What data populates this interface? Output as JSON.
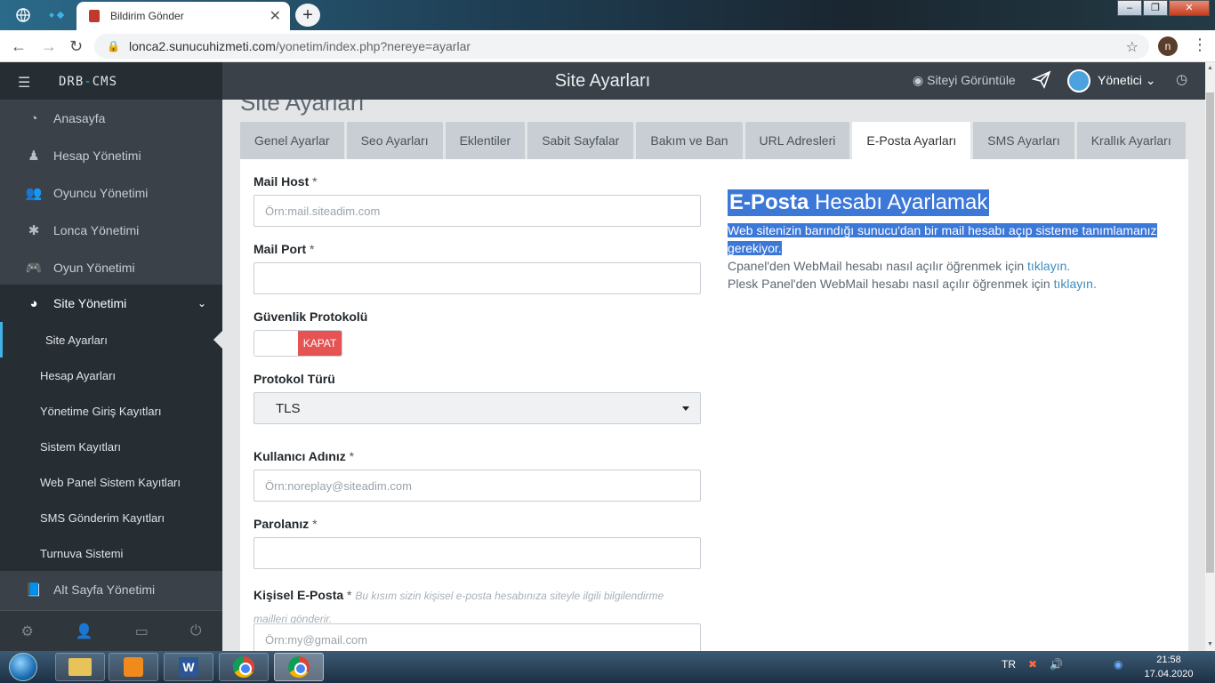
{
  "browser": {
    "tab_title": "Bildirim Gönder",
    "url_host": "lonca2.sunucuhizmeti.com",
    "url_path": "/yonetim/index.php?nereye=ayarlar",
    "profile_initial": "n"
  },
  "app": {
    "brand_left": "DRB",
    "brand_sep": "-",
    "brand_right": "CMS",
    "header_title": "Site Ayarları",
    "view_site": "Siteyi Görüntüle",
    "user_label": "Yönetici"
  },
  "sidebar": {
    "items": [
      {
        "label": "Anasayfa",
        "icon": "dashboard-icon"
      },
      {
        "label": "Hesap Yönetimi",
        "icon": "user-icon"
      },
      {
        "label": "Oyuncu Yönetimi",
        "icon": "users-icon"
      },
      {
        "label": "Lonca Yönetimi",
        "icon": "asterisk-icon"
      },
      {
        "label": "Oyun Yönetimi",
        "icon": "gamepad-icon"
      },
      {
        "label": "Site Yönetimi",
        "icon": "globe-icon"
      },
      {
        "label": "Alt Sayfa Yönetimi",
        "icon": "book-icon"
      }
    ],
    "submenu": [
      "Site Ayarları",
      "Hesap Ayarları",
      "Yönetime Giriş Kayıtları",
      "Sistem Kayıtları",
      "Web Panel Sistem Kayıtları",
      "SMS Gönderim Kayıtları",
      "Turnuva Sistemi"
    ]
  },
  "main": {
    "heading": "Site Ayarları",
    "tabs": [
      "Genel Ayarlar",
      "Seo Ayarları",
      "Eklentiler",
      "Sabit Sayfalar",
      "Bakım ve Ban",
      "URL Adresleri",
      "E-Posta Ayarları",
      "SMS Ayarları",
      "Krallık Ayarları"
    ],
    "active_tab": "E-Posta Ayarları",
    "form": {
      "mail_host_label": "Mail Host",
      "mail_host_placeholder": "Örn:mail.siteadim.com",
      "mail_port_label": "Mail Port",
      "mail_port_placeholder": "",
      "security_label": "Güvenlik Protokolü",
      "security_toggle": "KAPAT",
      "protocol_label": "Protokol Türü",
      "protocol_value": "TLS",
      "username_label": "Kullanıcı Adınız",
      "username_placeholder": "Örn:noreplay@siteadim.com",
      "password_label": "Parolanız",
      "password_placeholder": "",
      "personal_email_label": "Kişisel E-Posta",
      "personal_email_hint_1": "Bu kısım sizin kişisel e-posta hesabınıza siteyle ilgili bilgilendirme",
      "personal_email_hint_2": "mailleri gönderir.",
      "personal_email_placeholder": "Örn:my@gmail.com",
      "required_mark": "*"
    },
    "info": {
      "title_bold": "E-Posta",
      "title_rest": "Hesabı Ayarlamak",
      "line1": "Web sitenizin barındığı sunucu'dan bir mail hesabı açıp sisteme tanımlamanız gerekiyor.",
      "cpanel_text": "Cpanel'den WebMail hesabı nasıl açılır öğrenmek için",
      "plesk_text": "Plesk Panel'den WebMail hesabı nasıl açılır öğrenmek için",
      "link_text": "tıklayın."
    }
  },
  "taskbar": {
    "lang": "TR",
    "time": "21:58",
    "date": "17.04.2020"
  },
  "colors": {
    "sidebar": "#3a4149",
    "sidebar_dark": "#262d33",
    "accent": "#3fb3e6",
    "danger": "#e55353",
    "selection": "#3c78d8"
  }
}
